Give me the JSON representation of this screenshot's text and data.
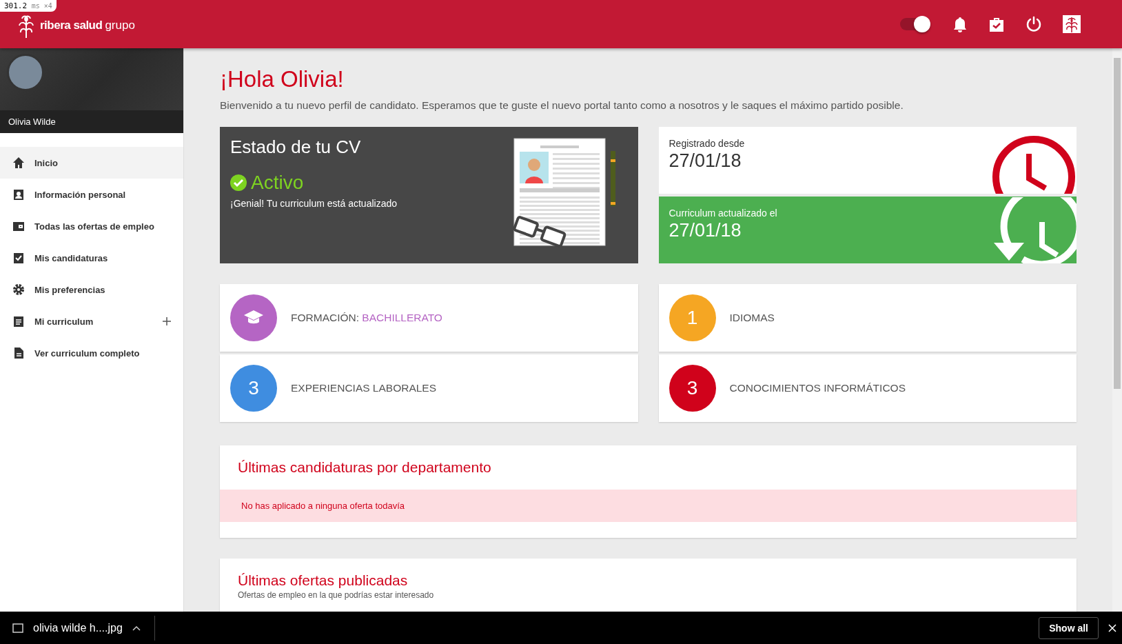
{
  "debug_badge": {
    "time": "301.2",
    "unit": "ms",
    "multiplier": "×4"
  },
  "header": {
    "logo_bold": "ribera salud",
    "logo_light": "grupo",
    "toggle_on": true
  },
  "profile": {
    "name": "Olivia Wilde"
  },
  "nav": [
    {
      "label": "Inicio",
      "kind": "home",
      "selected": true,
      "expandable": false
    },
    {
      "label": "Información personal",
      "kind": "badge",
      "selected": false,
      "expandable": false
    },
    {
      "label": "Todas las ofertas de empleo",
      "kind": "wallet",
      "selected": false,
      "expandable": false
    },
    {
      "label": "Mis candidaturas",
      "kind": "check",
      "selected": false,
      "expandable": false
    },
    {
      "label": "Mis preferencias",
      "kind": "gear",
      "selected": false,
      "expandable": false
    },
    {
      "label": "Mi curriculum",
      "kind": "clipboard",
      "selected": false,
      "expandable": true
    },
    {
      "label": "Ver curriculum completo",
      "kind": "file",
      "selected": false,
      "expandable": false
    }
  ],
  "greeting": "¡Hola Olivia!",
  "intro": "Bienvenido a tu nuevo perfil de candidato. Esperamos que te guste el nuevo portal tanto como a nosotros y le saques el máximo partido posible.",
  "cv_status": {
    "title": "Estado de tu CV",
    "status": "Activo",
    "message": "¡Genial! Tu curriculum está actualizado"
  },
  "dates": [
    {
      "label": "Registrado desde",
      "value": "27/01/18",
      "kind": "registered"
    },
    {
      "label": "Curriculum actualizado el",
      "value": "27/01/18",
      "kind": "updated"
    }
  ],
  "stats": [
    {
      "label": "FORMACIÓN:",
      "value": "BACHILLERATO",
      "color": "#b565c4",
      "kind": "icon"
    },
    {
      "badge": "1",
      "label": "IDIOMAS",
      "color": "#f5a623",
      "kind": "count"
    },
    {
      "badge": "3",
      "label": "EXPERIENCIAS LABORALES",
      "color": "#3f8de0",
      "kind": "count"
    },
    {
      "badge": "3",
      "label": "CONOCIMIENTOS INFORMÁTICOS",
      "color": "#d0021b",
      "kind": "count"
    }
  ],
  "applications": {
    "title": "Últimas candidaturas por departamento",
    "empty_message": "No has aplicado a ninguna oferta todavía"
  },
  "offers": {
    "title": "Últimas ofertas publicadas",
    "subtitle": "Ofertas de empleo en la que podrías estar interesado"
  },
  "download_bar": {
    "file": "olivia wilde h....jpg",
    "show_all": "Show all"
  }
}
